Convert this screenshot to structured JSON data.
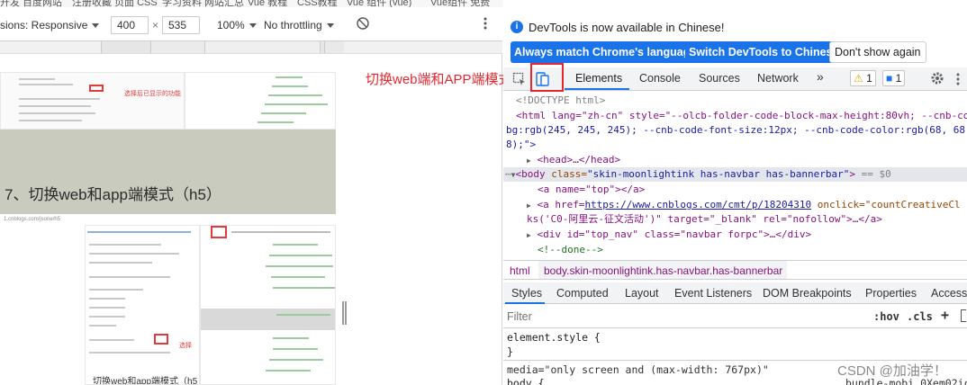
{
  "bookmarks": [
    "开发 百度网站",
    "注册收藏 页面 CSS",
    "学习资料 网站汇总",
    "Vue 教程",
    "CSS教程",
    "Vue 组件 (vue)",
    "Vue组件 免费"
  ],
  "device_toolbar": {
    "dimensions_label": "sions: Responsive",
    "width": "400",
    "height": "535",
    "separator": "×",
    "zoom": "100%",
    "throttle": "No throttling"
  },
  "page": {
    "heading": "7、切换web和app端模式（h5）",
    "note_top": "选择后已显示的功能",
    "note_bottom": "选择",
    "caption": "切换web和app端模式（h5",
    "url_text": "1.cnblogs.com/jsone/h5"
  },
  "annotation": "切换web端和APP端模式",
  "devtools": {
    "info_text": "DevTools is now available in Chinese!",
    "info_btn_match": "Always match Chrome's language",
    "info_btn_switch": "Switch DevTools to Chinese",
    "info_btn_dismiss": "Don't show again",
    "tabs": [
      "Elements",
      "Console",
      "Sources",
      "Network"
    ],
    "more": "»",
    "warn_count": "1",
    "msg_count": "1",
    "elements_lines": {
      "doctype": "<!DOCTYPE html>",
      "html_open_a": "<html lang=\"zh-cn\" style=\"--olcb-folder-code-block-max-height:80vh; --cnb-co",
      "html_open_b": "bg:rgb(245, 245, 245); --cnb-code-font-size:12px; --cnb-code-color:rgb(68, 68,",
      "html_open_c": "8);\">",
      "head": "<head>…</head>",
      "body_tag": "<body",
      "body_class_attr": "class=",
      "body_class_val": "\"skin-moonlightink has-navbar has-bannerbar\"",
      "body_eq": "== $0",
      "a_top": "<a name=\"top\"></a>",
      "a_href_pre": "<a href=",
      "a_href_url": "https://www.cnblogs.com/cmt/p/18204310",
      "a_href_post": " onclick=\"countCreativeCl",
      "a_href_line2": "ks('C0-阿里云-征文活动')\" target=\"_blank\" rel=\"nofollow\">…</a>",
      "div_topnav": "<div id=\"top_nav\" class=\"navbar forpc\">…</div>",
      "comment_done": "<!--done-->"
    },
    "breadcrumb": [
      "html",
      "body.skin-moonlightink.has-navbar.has-bannerbar"
    ],
    "subtabs": [
      "Styles",
      "Computed",
      "Layout",
      "Event Listeners",
      "DOM Breakpoints",
      "Properties",
      "Accessi"
    ],
    "filter_placeholder": "Filter",
    "hov": ":hov",
    "cls": ".cls",
    "plus": "+",
    "styles_lines": {
      "element_style": "element.style {",
      "close": "}",
      "media": "media=\"only screen and (max-width: 767px)\"",
      "body_rule": "body {",
      "source": "bundle-mobi 0Xem02ic"
    }
  },
  "watermark": "CSDN @加油学！",
  "colors": {
    "accent": "#1a73e8",
    "annotation": "#e8262e",
    "heading_band": "#c8cbbd"
  }
}
